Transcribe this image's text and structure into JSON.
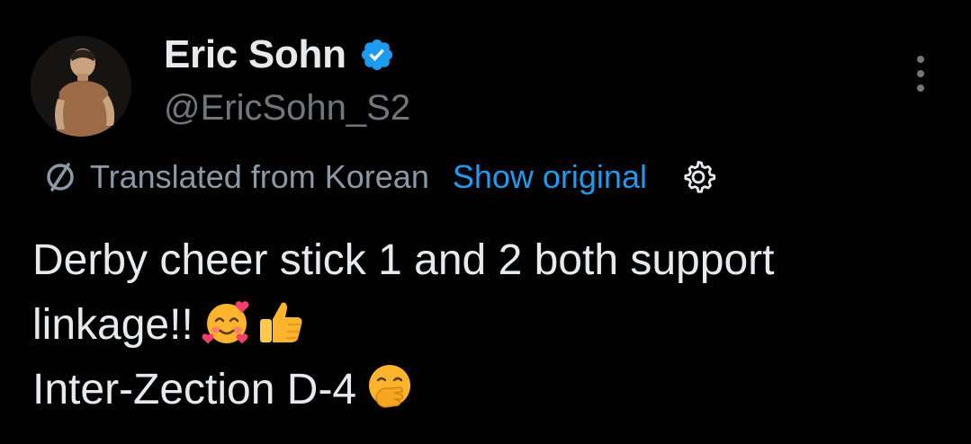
{
  "author": {
    "display_name": "Eric Sohn",
    "handle": "@EricSohn_S2",
    "verified": true
  },
  "translation": {
    "label": "Translated from Korean",
    "show_original": "Show original"
  },
  "tweet": {
    "line1": "Derby cheer stick 1 and 2 both support",
    "line2": "linkage!!",
    "line3": "Inter-Zection D-4"
  },
  "icons": {
    "verified": "verified-badge-icon",
    "more": "more-options-icon",
    "translate": "translate-icon",
    "settings": "settings-gear-icon",
    "emoji_hearts": "smiling-face-with-hearts-emoji",
    "emoji_thumbs": "thumbs-up-emoji",
    "emoji_hand_mouth": "face-with-hand-over-mouth-emoji"
  },
  "colors": {
    "background": "#000000",
    "text_primary": "#e7e9ea",
    "text_secondary": "#71767b",
    "link": "#1d9bf0",
    "verified_badge": "#1d9bf0"
  }
}
